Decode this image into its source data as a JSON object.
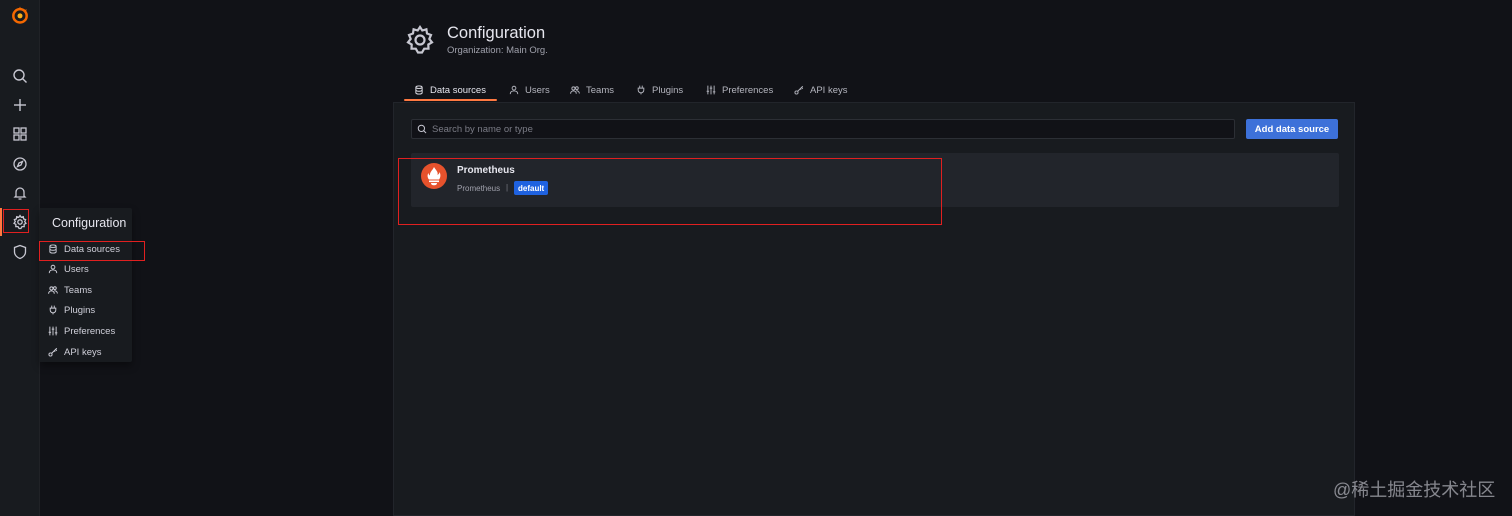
{
  "rail": {
    "icons": [
      "grafana-logo-icon",
      "search-icon",
      "plus-icon",
      "dashboards-icon",
      "explore-icon",
      "alerting-bell-icon",
      "configuration-gear-icon",
      "server-admin-shield-icon"
    ]
  },
  "flyout": {
    "title": "Configuration",
    "items": [
      {
        "label": "Data sources",
        "icon": "database-icon"
      },
      {
        "label": "Users",
        "icon": "user-icon"
      },
      {
        "label": "Teams",
        "icon": "users-icon"
      },
      {
        "label": "Plugins",
        "icon": "plug-icon"
      },
      {
        "label": "Preferences",
        "icon": "sliders-icon"
      },
      {
        "label": "API keys",
        "icon": "key-icon"
      }
    ]
  },
  "header": {
    "title": "Configuration",
    "subtitle": "Organization: Main Org."
  },
  "tabs": [
    {
      "label": "Data sources",
      "icon": "database-icon",
      "active": true
    },
    {
      "label": "Users",
      "icon": "user-icon"
    },
    {
      "label": "Teams",
      "icon": "users-icon"
    },
    {
      "label": "Plugins",
      "icon": "plug-icon"
    },
    {
      "label": "Preferences",
      "icon": "sliders-icon"
    },
    {
      "label": "API keys",
      "icon": "key-icon"
    }
  ],
  "search": {
    "placeholder": "Search by name or type",
    "value": ""
  },
  "add_button": {
    "label": "Add data source"
  },
  "datasources": [
    {
      "name": "Prometheus",
      "type": "Prometheus",
      "separator": "|",
      "badge": "default",
      "icon": "prometheus-logo-icon"
    }
  ],
  "colors": {
    "accent": "#ff7941",
    "primary": "#3d71d9",
    "badge": "#1f62e0",
    "highlight": "#e02020",
    "prometheus": "#e6522c"
  },
  "watermark": "@稀土掘金技术社区"
}
